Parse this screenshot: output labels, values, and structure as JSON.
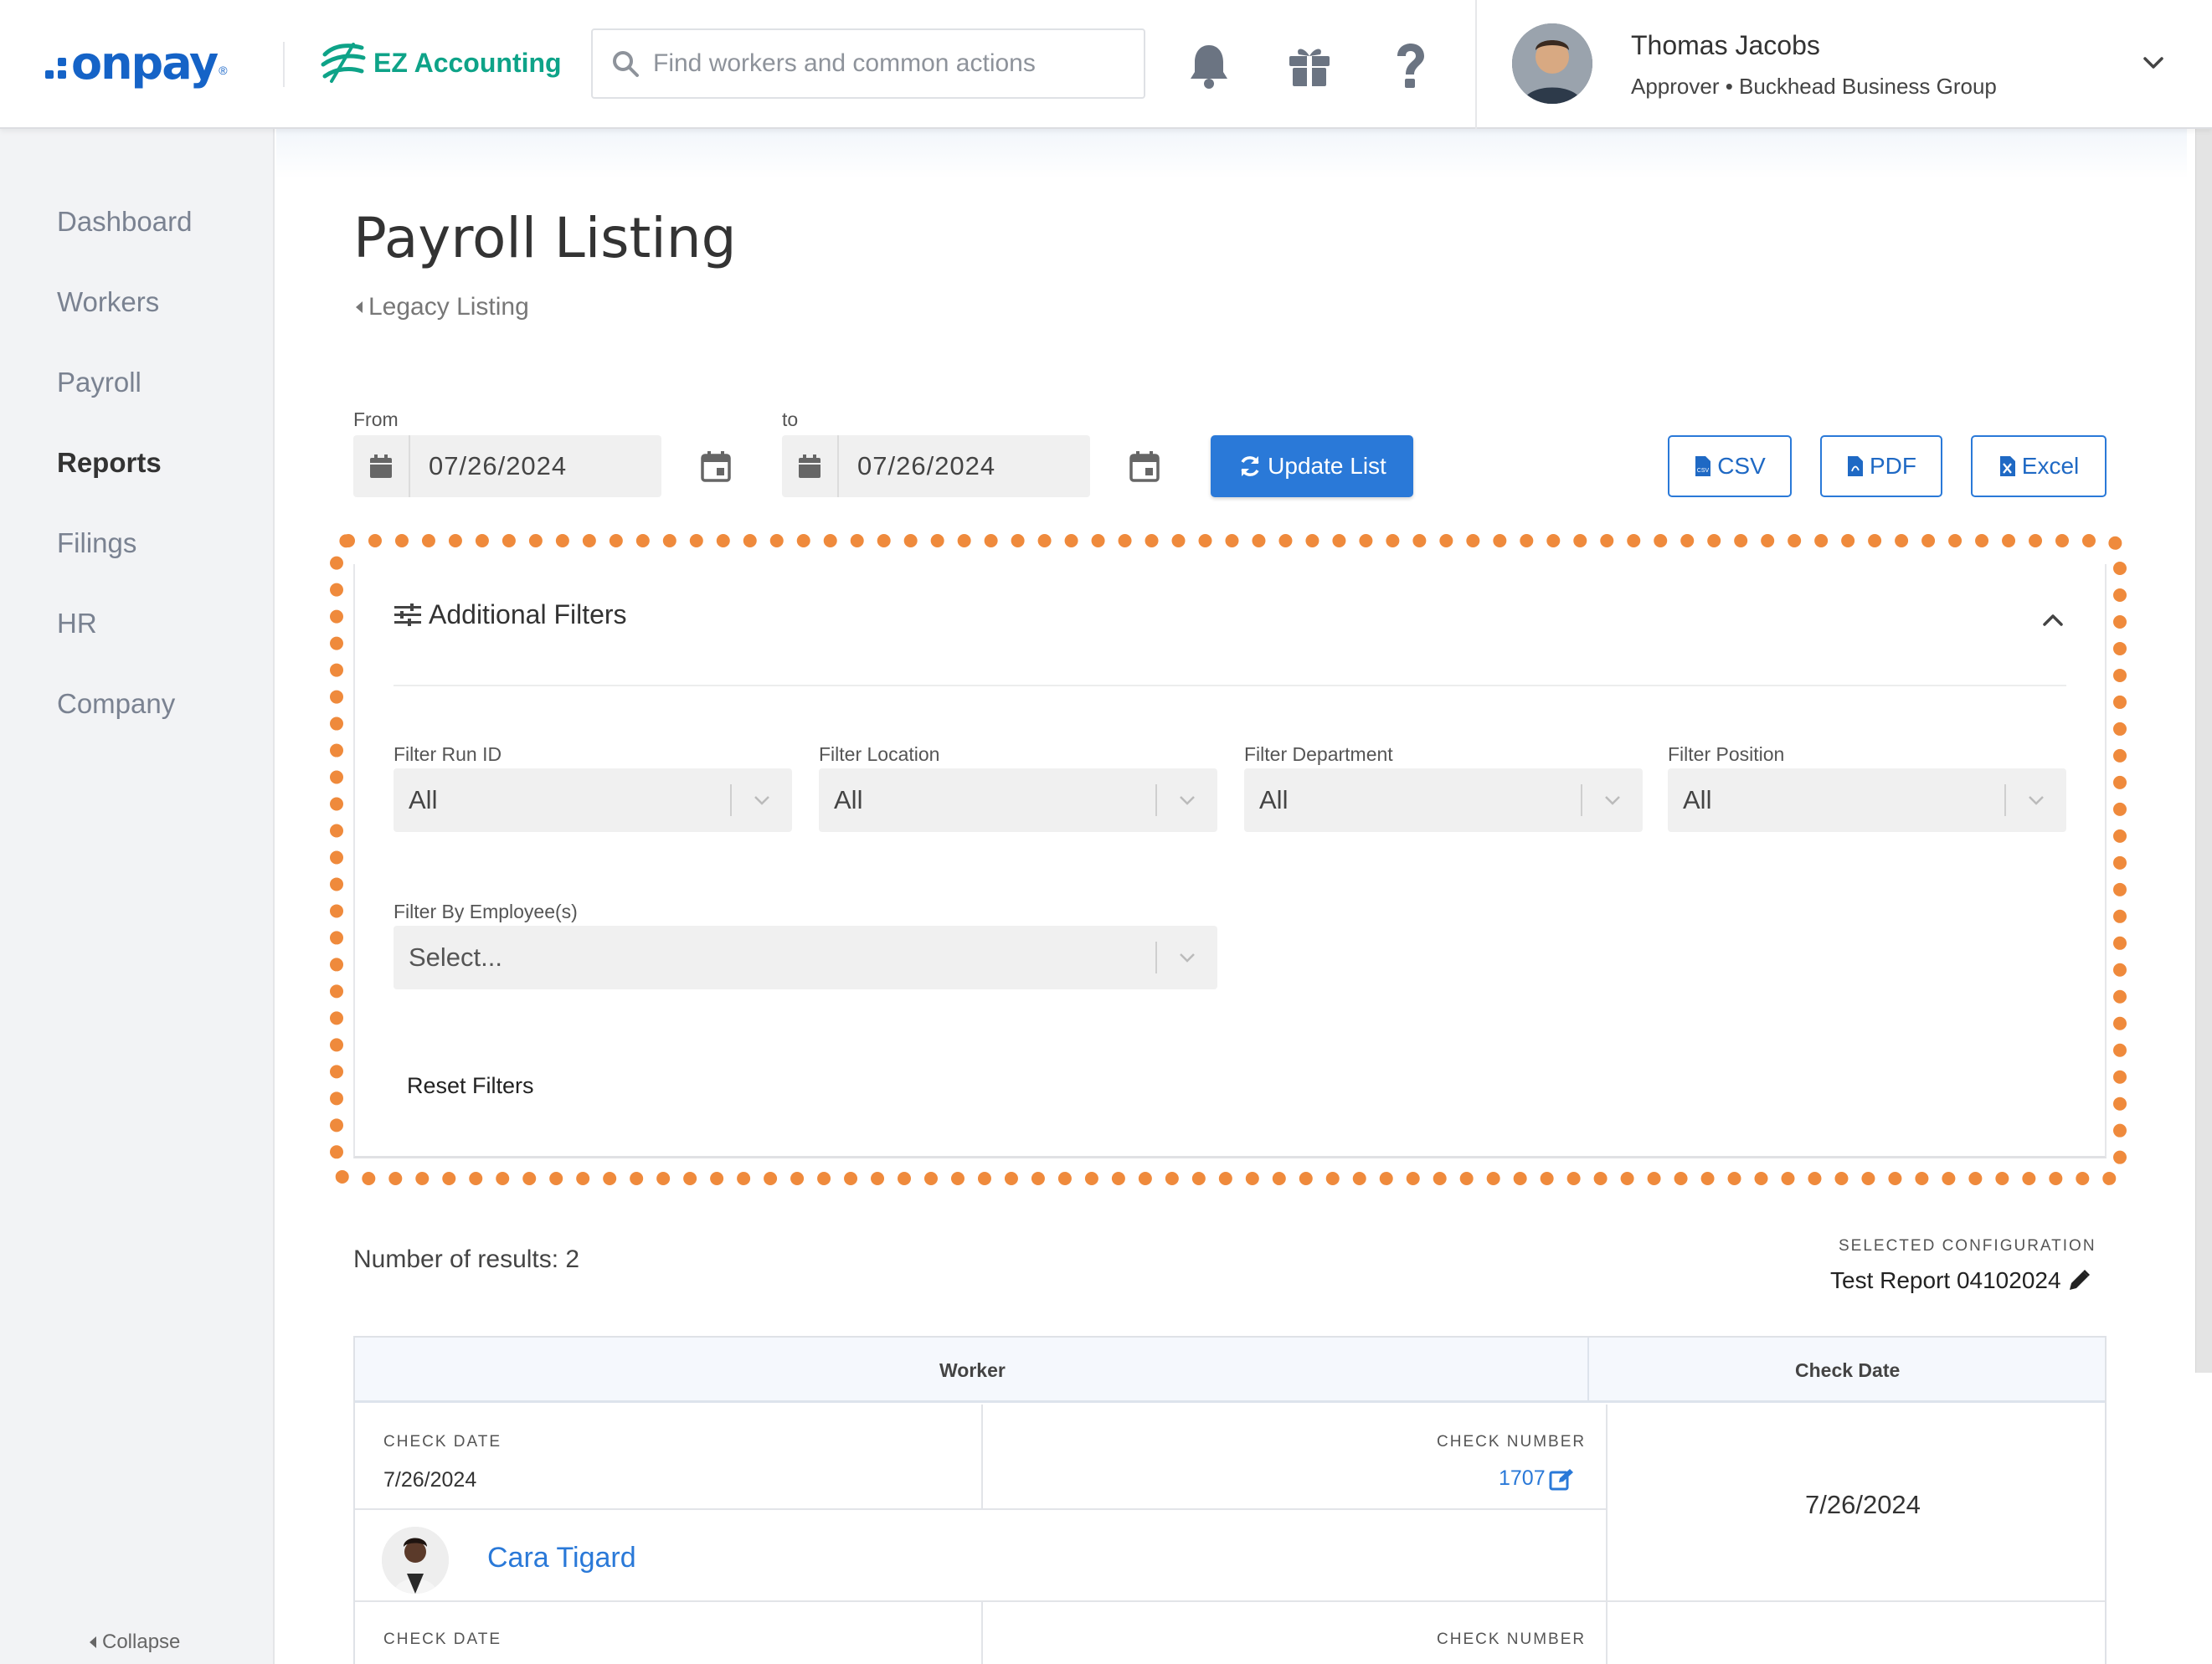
{
  "header": {
    "logo_text": "onpay",
    "partner_logo_text": "EZ Accounting",
    "search_placeholder": "Find workers and common actions",
    "user": {
      "name": "Thomas Jacobs",
      "role": "Approver • Buckhead Business Group"
    },
    "icons": [
      "bell-icon",
      "gift-icon",
      "help-icon",
      "chevron-down-icon"
    ]
  },
  "sidebar": {
    "items": [
      {
        "label": "Dashboard",
        "active": false
      },
      {
        "label": "Workers",
        "active": false
      },
      {
        "label": "Payroll",
        "active": false
      },
      {
        "label": "Reports",
        "active": true
      },
      {
        "label": "Filings",
        "active": false
      },
      {
        "label": "HR",
        "active": false
      },
      {
        "label": "Company",
        "active": false
      }
    ],
    "collapse_label": "Collapse"
  },
  "page": {
    "title": "Payroll Listing",
    "legacy_link": "Legacy Listing"
  },
  "date_range": {
    "from_label": "From",
    "from_value": "07/26/2024",
    "to_label": "to",
    "to_value": "07/26/2024",
    "update_button": "Update List"
  },
  "exports": {
    "csv": "CSV",
    "pdf": "PDF",
    "excel": "Excel"
  },
  "filters": {
    "title": "Additional Filters",
    "run_id": {
      "label": "Filter Run ID",
      "value": "All"
    },
    "location": {
      "label": "Filter Location",
      "value": "All"
    },
    "department": {
      "label": "Filter Department",
      "value": "All"
    },
    "position": {
      "label": "Filter Position",
      "value": "All"
    },
    "employees": {
      "label": "Filter By Employee(s)",
      "placeholder": "Select..."
    },
    "reset_label": "Reset Filters",
    "highlight_color": "#ef8a3c"
  },
  "results": {
    "count_label": "Number of results: 2",
    "selected_config_label": "SELECTED CONFIGURATION",
    "selected_config_value": "Test Report 04102024"
  },
  "table": {
    "headers": [
      "Worker",
      "Check Date"
    ],
    "rows": [
      {
        "check_date_label": "CHECK DATE",
        "check_date": "7/26/2024",
        "check_number_label": "CHECK NUMBER",
        "check_number": "1707",
        "worker_name": "Cara Tigard",
        "check_date_col": "7/26/2024"
      },
      {
        "check_date_label": "CHECK DATE",
        "check_number_label": "CHECK NUMBER"
      }
    ]
  },
  "colors": {
    "brand_blue": "#1563c7",
    "primary_button": "#2a79d8",
    "ez_green": "#0ea388"
  }
}
